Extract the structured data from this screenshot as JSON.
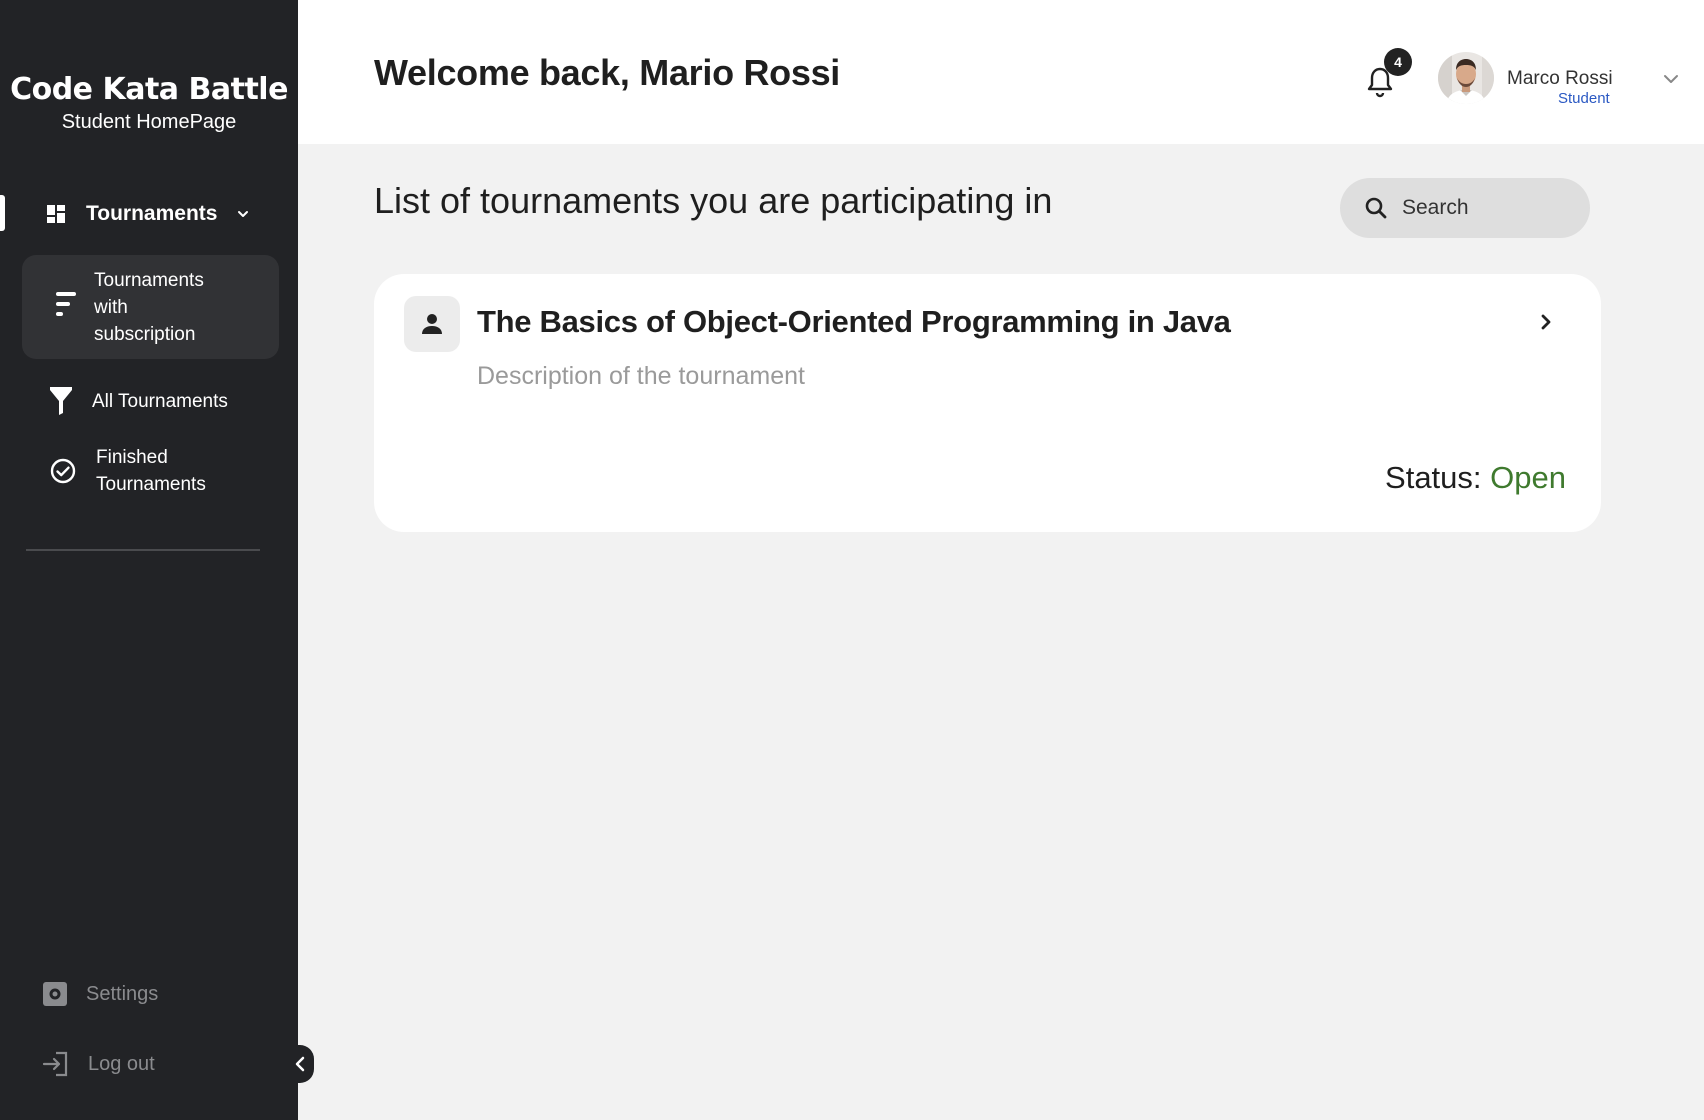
{
  "sidebar": {
    "brand_title": "Code Kata Battle",
    "brand_subtitle": "Student HomePage",
    "nav": {
      "main_label": "Tournaments",
      "items": [
        {
          "label": "Tournaments with subscription",
          "icon": "filter-list-icon",
          "active": true
        },
        {
          "label": "All Tournaments",
          "icon": "funnel-icon",
          "active": false
        },
        {
          "label": "Finished Tournaments",
          "icon": "check-circle-icon",
          "active": false
        }
      ]
    },
    "settings_label": "Settings",
    "logout_label": "Log out"
  },
  "header": {
    "welcome": "Welcome back, Mario Rossi",
    "notification_count": "4",
    "user_name": "Marco Rossi",
    "user_role": "Student"
  },
  "main": {
    "list_title": "List of tournaments you are participating in",
    "search_placeholder": "Search",
    "tournaments": [
      {
        "title": "The Basics of Object-Oriented Programming in Java",
        "description": "Description of the tournament",
        "status_label": "Status:",
        "status_value": "Open"
      }
    ]
  },
  "colors": {
    "sidebar_bg": "#222326",
    "status_open": "#3f7a2e",
    "role_link": "#2b59c3"
  }
}
